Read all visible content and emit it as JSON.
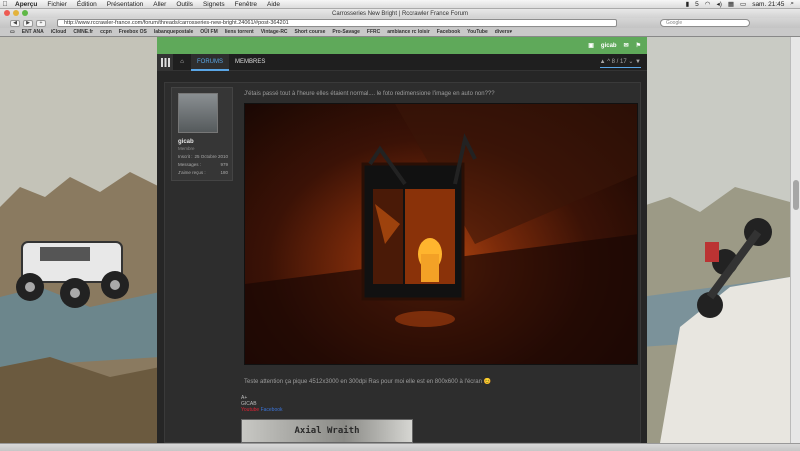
{
  "menubar": {
    "app": "Aperçu",
    "items": [
      "Fichier",
      "Édition",
      "Présentation",
      "Aller",
      "Outils",
      "Signets",
      "Fenêtre",
      "Aide"
    ],
    "battery": "5",
    "clock": "sam. 21:45"
  },
  "window": {
    "title": "Carrosseries New Bright | Rccrawler France Forum"
  },
  "toolbar": {
    "back": "◀",
    "forward": "▶",
    "add": "+",
    "url": "http://www.rccrawler-france.com/forum/threads/carrosseries-new-bright.24061/#post-364201",
    "search_placeholder": "Google"
  },
  "bookmarks": [
    "ENT ANA",
    "iCloud",
    "CMNE.fr",
    "ccpn",
    "Freebox OS",
    "labanquepostale",
    "OÜI FM",
    "liens torrent",
    "Vintage-RC",
    "Short course",
    "Pro-Savage",
    "FFRC",
    "ambiance rc loisir",
    "Facebook",
    "YouTube",
    "divers▾"
  ],
  "forum": {
    "user_link": "gicab",
    "tabs": [
      {
        "label": "FORUMS",
        "active": true
      },
      {
        "label": "MEMBRES",
        "active": false
      }
    ],
    "pager": "▲ ^ 8 / 17 ⌄ ▼"
  },
  "post": {
    "author": {
      "name": "gicab",
      "role": "Membre",
      "stats": [
        {
          "label": "Inscrit :",
          "value": "25 Octobre 2010"
        },
        {
          "label": "Messages :",
          "value": "979"
        },
        {
          "label": "J'aime reçus :",
          "value": "180"
        }
      ]
    },
    "message": "J'étais passé tout à l'heure elles étaient normal.... le foto redimensione l'image en auto non???",
    "caption": "Teste attention ça pique 4512x3000 en 300dpi Ras pour moi elle est en 800x600 à l'écran 😊",
    "signature": {
      "line1": "A+",
      "line2": "GICAB",
      "link_red": "Youtube",
      "link_blue": "Facebook",
      "banner_text": "Axial Wraith"
    }
  },
  "colors": {
    "forum_green": "#5fa95a",
    "link_blue": "#5aa6e6",
    "forum_bg": "#262626"
  }
}
